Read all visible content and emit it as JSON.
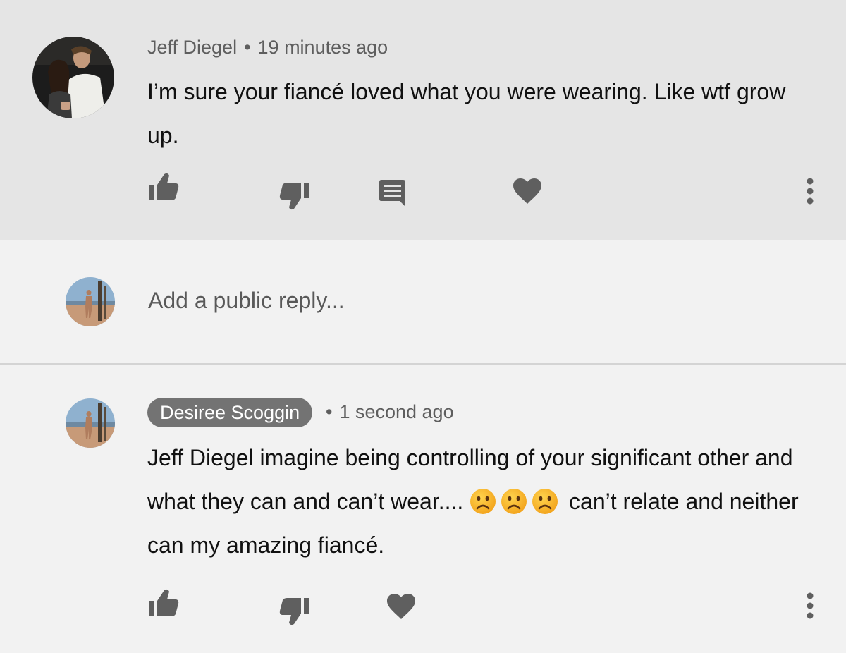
{
  "colors": {
    "highlight_bg": "#e5e5e5",
    "page_bg": "#f2f2f2",
    "icon_grey": "#5f5f5f",
    "chip_bg": "#737373"
  },
  "highlighted_comment": {
    "author": "Jeff Diegel",
    "separator": "•",
    "timestamp": "19 minutes ago",
    "text": "I’m sure your fiancé loved what you were wearing. Like wtf grow up.",
    "actions": [
      "like-icon",
      "dislike-icon",
      "reply-icon",
      "heart-icon",
      "more-vert-icon"
    ]
  },
  "reply_box": {
    "placeholder": "Add a public reply..."
  },
  "reply_comment": {
    "author": "Desiree Scoggin",
    "separator": "•",
    "timestamp": "1 second ago",
    "text_part1": "Jeff Diegel imagine being controlling of your significant other and what they can and can’t wear....",
    "emoji": [
      "🙁",
      "🙁",
      "🙁"
    ],
    "text_part2": "can’t relate and neither can my amazing fiancé.",
    "actions": [
      "like-icon",
      "dislike-icon",
      "heart-icon",
      "more-vert-icon"
    ]
  }
}
